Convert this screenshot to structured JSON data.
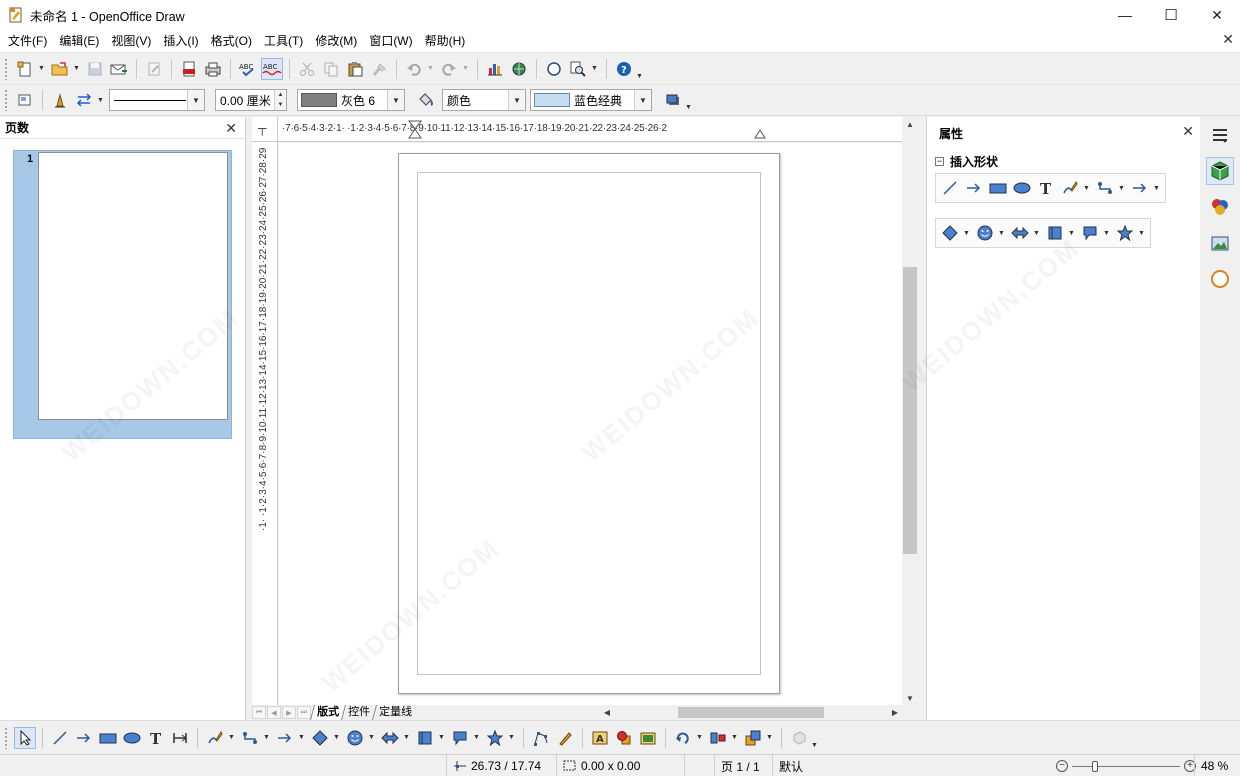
{
  "window": {
    "title": "未命名 1 - OpenOffice Draw",
    "minimize": "—",
    "maximize": "☐",
    "close": "✕"
  },
  "menu": {
    "items": [
      "文件(F)",
      "编辑(E)",
      "视图(V)",
      "插入(I)",
      "格式(O)",
      "工具(T)",
      "修改(M)",
      "窗口(W)",
      "帮助(H)"
    ],
    "doc_close": "✕"
  },
  "line_toolbar": {
    "line_width": "0.00 厘米",
    "line_color": "灰色 6",
    "area_style": "颜色",
    "area_color": "蓝色经典"
  },
  "page_pane": {
    "title": "页数",
    "close": "✕",
    "thumbnails": [
      {
        "number": "1"
      }
    ]
  },
  "rulers": {
    "horizontal": "·7·6·5·4·3·2·1· ·1·2·3·4·5·6·7·8·9·10·11·12·13·14·15·16·17·18·19·20·21·22·23·24·25·26·2",
    "vertical": "·1· ·1·2·3·4·5·6·7·8·9·10·11·12·13·14·15·16·17·18·19·20·21·22·23·24·25·26·27·28·29"
  },
  "layer_tabs": [
    "版式",
    "控件",
    "定量线"
  ],
  "properties_pane": {
    "title": "属性",
    "close": "✕",
    "section": "插入形状",
    "collapse": "⊟"
  },
  "statusbar": {
    "position": "26.73 / 17.74",
    "size": "0.00 x 0.00",
    "page": "页 1 / 1",
    "page_style": "默认",
    "zoom": "48 %",
    "zoom_level": 0.48
  },
  "colors": {
    "line_swatch": "#808080",
    "area_swatch": "#c6dcf0",
    "selection": "#a8c8e8",
    "help_icon": "#1a5fb4"
  },
  "watermark": "WEIDOWN.COM"
}
